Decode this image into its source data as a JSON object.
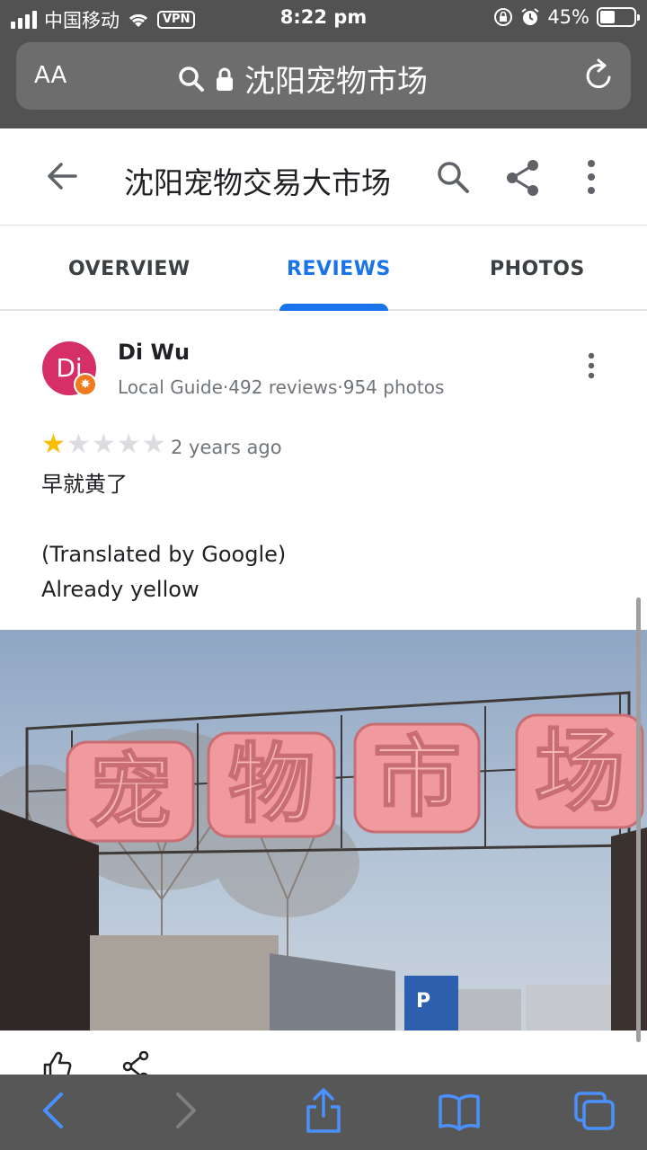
{
  "status_bar": {
    "carrier": "中国移动",
    "vpn": "VPN",
    "time": "8:22 pm",
    "battery": "45%",
    "battery_level": 0.45,
    "icons": [
      "signal-icon",
      "wifi-icon",
      "orientation-lock-icon",
      "alarm-icon",
      "battery-icon"
    ]
  },
  "browser": {
    "text_size_label": "AA",
    "url_text": "沈阳宠物市场",
    "icons": [
      "search-icon",
      "lock-icon",
      "reload-icon"
    ]
  },
  "app_bar": {
    "title": "沈阳宠物交易大市场",
    "icons": [
      "back-arrow-icon",
      "search-icon",
      "share-icon",
      "more-vert-icon"
    ]
  },
  "tabs": [
    {
      "label": "OVERVIEW",
      "active": false
    },
    {
      "label": "REVIEWS",
      "active": true
    },
    {
      "label": "PHOTOS",
      "active": false
    }
  ],
  "review": {
    "avatar_initials": "Di",
    "author": "Di Wu",
    "meta": "Local Guide·492 reviews·954 photos",
    "rating": 1,
    "rating_max": 5,
    "time_ago": "2 years ago",
    "original_text": "早就黄了",
    "translated_label": "(Translated by Google)",
    "translated_text": "Already yellow",
    "photo_sign_text": "宠物市场",
    "actions": [
      "thumbs-up-icon",
      "share-icon"
    ]
  },
  "toolbar": {
    "icons": [
      "back-icon",
      "forward-icon",
      "share-icon",
      "bookmarks-icon",
      "tabs-icon"
    ]
  },
  "colors": {
    "accent": "#1a73e8",
    "avatar": "#d62f67",
    "star": "#fbbc04",
    "toolbar_icon": "#4a90ff"
  }
}
